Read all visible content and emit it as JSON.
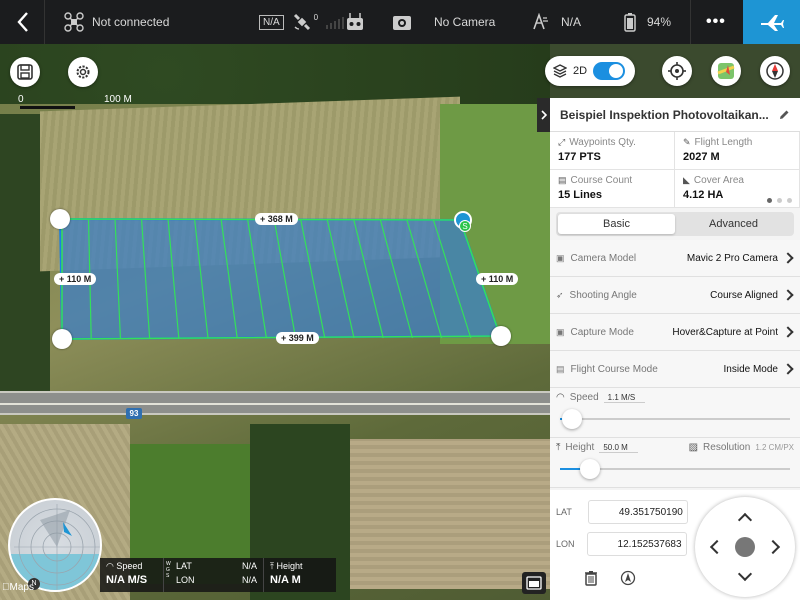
{
  "topbar": {
    "connection": "Not connected",
    "signal_badge": "N/A",
    "satellite_count": "0",
    "camera": "No Camera",
    "gps": "N/A",
    "battery": "94%",
    "more": "•••"
  },
  "map": {
    "scale_zero": "0",
    "scale_label": "100 M",
    "toggle_label": "2D",
    "highway_number": "93",
    "distances": {
      "top": "+ 368 M",
      "left": "+ 110 M",
      "right": "+ 110 M",
      "bottom": "+ 399 M"
    },
    "start_marker": "S",
    "maps_logo": "Maps"
  },
  "panel": {
    "title": "Beispiel Inspektion Photovoltaikan...",
    "stats": [
      {
        "label": "Waypoints Qty.",
        "value": "177 PTS"
      },
      {
        "label": "Flight Length",
        "value": "2027 M"
      },
      {
        "label": "Course Count",
        "value": "15 Lines"
      },
      {
        "label": "Cover Area",
        "value": "4.12 HA"
      }
    ],
    "tabs": [
      "Basic",
      "Advanced"
    ],
    "rows": [
      {
        "label": "Camera Model",
        "value": "Mavic 2 Pro Camera"
      },
      {
        "label": "Shooting Angle",
        "value": "Course Aligned"
      },
      {
        "label": "Capture Mode",
        "value": "Hover&Capture at Point"
      },
      {
        "label": "Flight Course Mode",
        "value": "Inside Mode"
      }
    ],
    "speed": {
      "label": "Speed",
      "value": "1.1 M/S",
      "level": 0.05
    },
    "height": {
      "label": "Height",
      "value": "50.0 M",
      "resolution_label": "Resolution",
      "resolution_value": "1.2 CM/PX",
      "level": 0.13
    }
  },
  "coords": {
    "lat_label": "LAT",
    "lat_value": "49.351750190",
    "lon_label": "LON",
    "lon_value": "12.152537683"
  },
  "telemetry": {
    "speed_label": "Speed",
    "speed_value": "N/A M/S",
    "lat_label": "LAT",
    "lat_value": "N/A",
    "lon_label": "LON",
    "lon_value": "N/A",
    "wgs": "W G S",
    "height_label": "Height",
    "height_value": "N/A M"
  },
  "colors": {
    "accent": "#1e95d4",
    "polygon_fill": "#3d7fc4",
    "polygon_line": "#34e05a"
  }
}
